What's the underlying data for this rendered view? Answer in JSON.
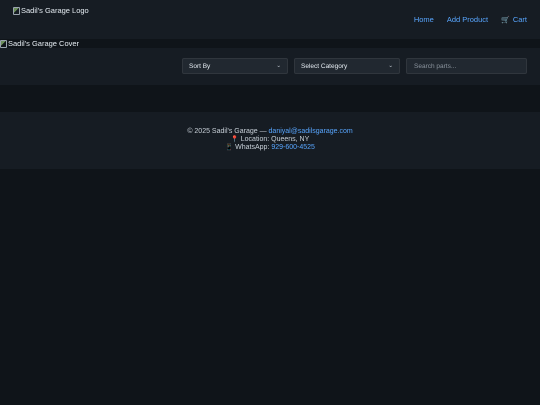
{
  "header": {
    "logo_alt": "Sadil's Garage Logo",
    "nav": {
      "home": "Home",
      "add_product": "Add Product",
      "cart": "Cart",
      "cart_icon": "shopping-cart-icon"
    }
  },
  "cover": {
    "alt": "Sadil's Garage Cover"
  },
  "filters": {
    "sort_label": "Sort By",
    "category_label": "Select Category",
    "search_placeholder": "Search parts..."
  },
  "footer": {
    "copyright_prefix": "© 2025 Sadil's Garage —",
    "email": "daniyal@sadilsgarage.com",
    "location_label": "Location:",
    "location_value": "Queens, NY",
    "whatsapp_label": "WhatsApp:",
    "whatsapp_number": "929-600-4525"
  },
  "colors": {
    "background": "#0f1419",
    "panel": "#161c23",
    "link": "#58a6ff",
    "text": "#c9d1d9"
  }
}
